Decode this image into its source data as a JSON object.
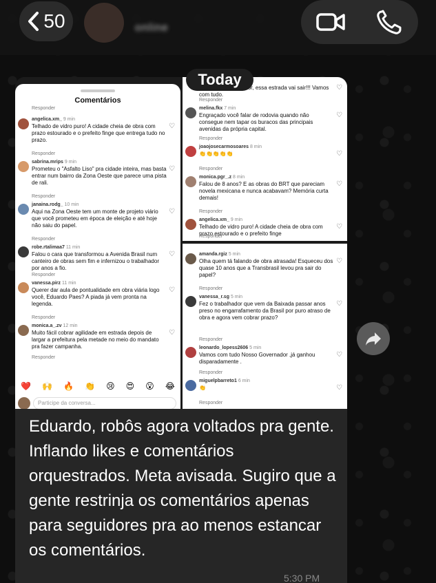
{
  "header": {
    "unread_count": "50",
    "contact_name": "online"
  },
  "date_pill": "Today",
  "shared_image": {
    "left": {
      "title": "Comentários",
      "reply_label": "Responder",
      "comments": [
        {
          "user": "angelica.xm_",
          "time": "9 min",
          "text": "Telhado de vidro puro! A cidade cheia de obra com prazo estourado e o prefeito finge que entrega tudo no prazo.",
          "color": "#a0523d"
        },
        {
          "user": "sabrina.mrips",
          "time": "9 min",
          "text": "Prometeu o \"Asfalto Liso\" pra cidade inteira, mas basta entrar num bairro da Zona Oeste que parece uma pista de rali.",
          "color": "#d79a6a"
        },
        {
          "user": "janaina.rodg_",
          "time": "10 min",
          "text": "Aqui na Zona Oeste tem um monte de projeto viário que você prometeu em época de eleição e até hoje não saiu do papel.",
          "color": "#6a8ab0"
        },
        {
          "user": "robe.rtalimaa7",
          "time": "11 min",
          "text": "Falou o cara que transformou a Avenida Brasil num canteiro de obras sem fim e infernizou o trabalhador por anos a fio.",
          "color": "#3a3a3a"
        },
        {
          "user": "vanessa.pirz",
          "time": "11 min",
          "text": "Querer dar aula de pontualidade em obra viária logo você, Eduardo Paes? A piada já vem pronta na legenda.",
          "color": "#c98a5a"
        },
        {
          "user": "monica.a_.zv",
          "time": "12 min",
          "text": "Muito fácil cobrar agilidade em estrada depois de largar a prefeitura pela metade no meio do mandato pra fazer campanha.",
          "color": "#8a6a50"
        }
      ],
      "emojis": [
        "❤️",
        "🙌",
        "🔥",
        "👏",
        "😢",
        "😍",
        "😮",
        "😂"
      ],
      "input_placeholder": "Participe da conversa..."
    },
    "right_top": {
      "reply_label": "Responder",
      "comments": [
        {
          "user": "",
          "time": "",
          "text": "bens meu governador, essa estrada vai sair!!! Vamos com tudo.",
          "color": "#ffffff"
        },
        {
          "user": "melina.fkx",
          "time": "7 min",
          "text": "Engraçado você falar de rodovia quando não consegue nem tapar os buracos das principais avenidas da própria capital.",
          "color": "#555555"
        },
        {
          "user": "joaojosecarmosoares",
          "time": "8 min",
          "text": "👏👏👏👏👏",
          "color": "#c04040"
        },
        {
          "user": "monica.pgr_.z",
          "time": "8 min",
          "text": "Falou de 8 anos? E as obras do BRT que pareciam novela mexicana e nunca acabavam? Memória curta demais!",
          "color": "#a08070"
        },
        {
          "user": "angelica.xm_",
          "time": "9 min",
          "text": "Telhado de vidro puro! A cidade cheia de obra com prazo estourado e o prefeito finge",
          "color": "#a0523d"
        }
      ]
    },
    "right_bottom": {
      "reply_label": "Responder",
      "comments": [
        {
          "user": "amanda.rgiz",
          "time": "5 min",
          "text": "Olha quem tá falando de obra atrasada! Esqueceu dos quase 10 anos que a Transbrasil levou pra sair do papel?",
          "color": "#6a5a4a"
        },
        {
          "user": "vanessa_r.sg",
          "time": "5 min",
          "text": "Fez o trabalhador que vem da Baixada passar anos preso no engarrafamento da Brasil por puro atraso de obra e agora vem cobrar prazo?",
          "color": "#3a3a3a"
        },
        {
          "user": "leonardo_lopess2606",
          "time": "5 min",
          "text": "Vamos com tudo Nosso Governador ,já ganhou disparadamente .",
          "color": "#b04040"
        },
        {
          "user": "miguelpbarreto1",
          "time": "6 min",
          "text": "👏",
          "color": "#4a6aa0"
        }
      ]
    }
  },
  "message": {
    "text": "Eduardo, robôs agora voltados pra gente. Inflando likes e comentários orquestrados. Meta avisada. Sugiro que a gente restrinja os comentários apenas para seguidores pra ao menos estancar os comentários.",
    "time": "5:30 PM"
  }
}
